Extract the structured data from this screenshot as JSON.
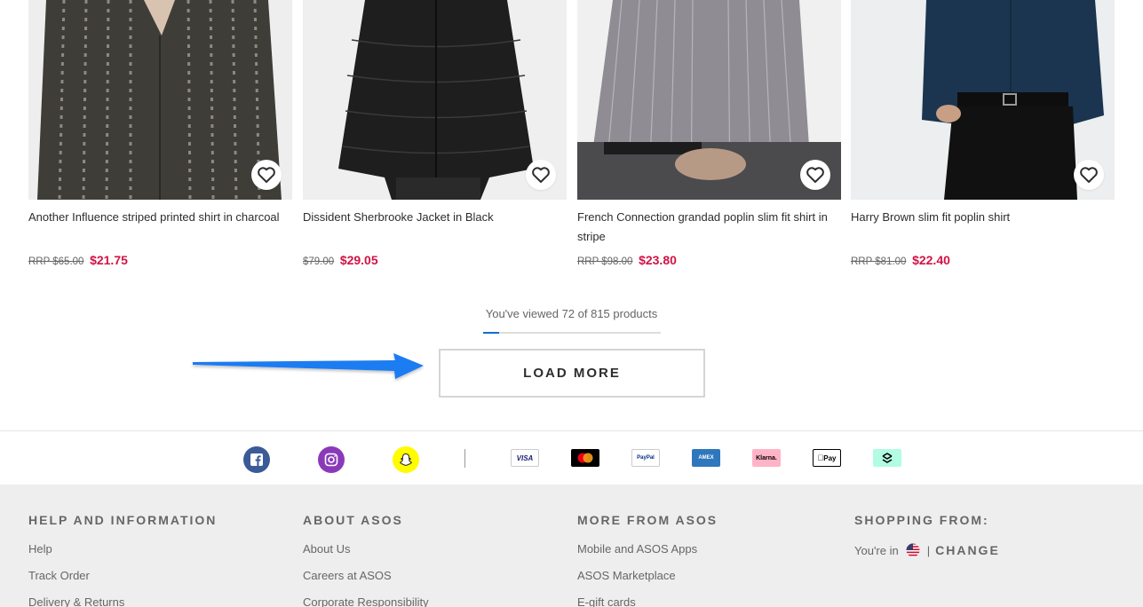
{
  "products": [
    {
      "name": "Another Influence striped printed shirt in charcoal",
      "rrp": "RRP $65.00",
      "price": "$21.75"
    },
    {
      "name": "Dissident Sherbrooke Jacket in Black",
      "rrp": "$79.00",
      "price": "$29.05"
    },
    {
      "name": "French Connection grandad poplin slim fit shirt in stripe",
      "rrp": "RRP $98.00",
      "price": "$23.80"
    },
    {
      "name": "Harry Brown slim fit poplin shirt",
      "rrp": "RRP $81.00",
      "price": "$22.40"
    }
  ],
  "progress": {
    "text": "You've viewed 72 of 815 products",
    "viewed": 72,
    "total": 815
  },
  "load_more_label": "LOAD MORE",
  "social": [
    "facebook-icon",
    "instagram-icon",
    "snapchat-icon"
  ],
  "payments": {
    "visa": "VISA",
    "mastercard": "",
    "paypal": "PayPal",
    "amex": "AMEX",
    "klarna": "Klarna.",
    "applepay": "Pay",
    "afterpay": ""
  },
  "footer": {
    "help": {
      "title": "HELP AND INFORMATION",
      "links": [
        "Help",
        "Track Order",
        "Delivery & Returns"
      ]
    },
    "about": {
      "title": "ABOUT ASOS",
      "links": [
        "About Us",
        "Careers at ASOS",
        "Corporate Responsibility"
      ]
    },
    "more": {
      "title": "MORE FROM ASOS",
      "links": [
        "Mobile and ASOS Apps",
        "ASOS Marketplace",
        "E-gift cards"
      ]
    },
    "shopping": {
      "title": "SHOPPING FROM:",
      "youre_in": "You're in",
      "separator": "|",
      "change": "CHANGE"
    }
  },
  "colors": {
    "sale_price": "#d01345",
    "progress_fill": "#0770cf",
    "arrow": "#1a7bf2",
    "footer_bg": "#eeeeee"
  }
}
